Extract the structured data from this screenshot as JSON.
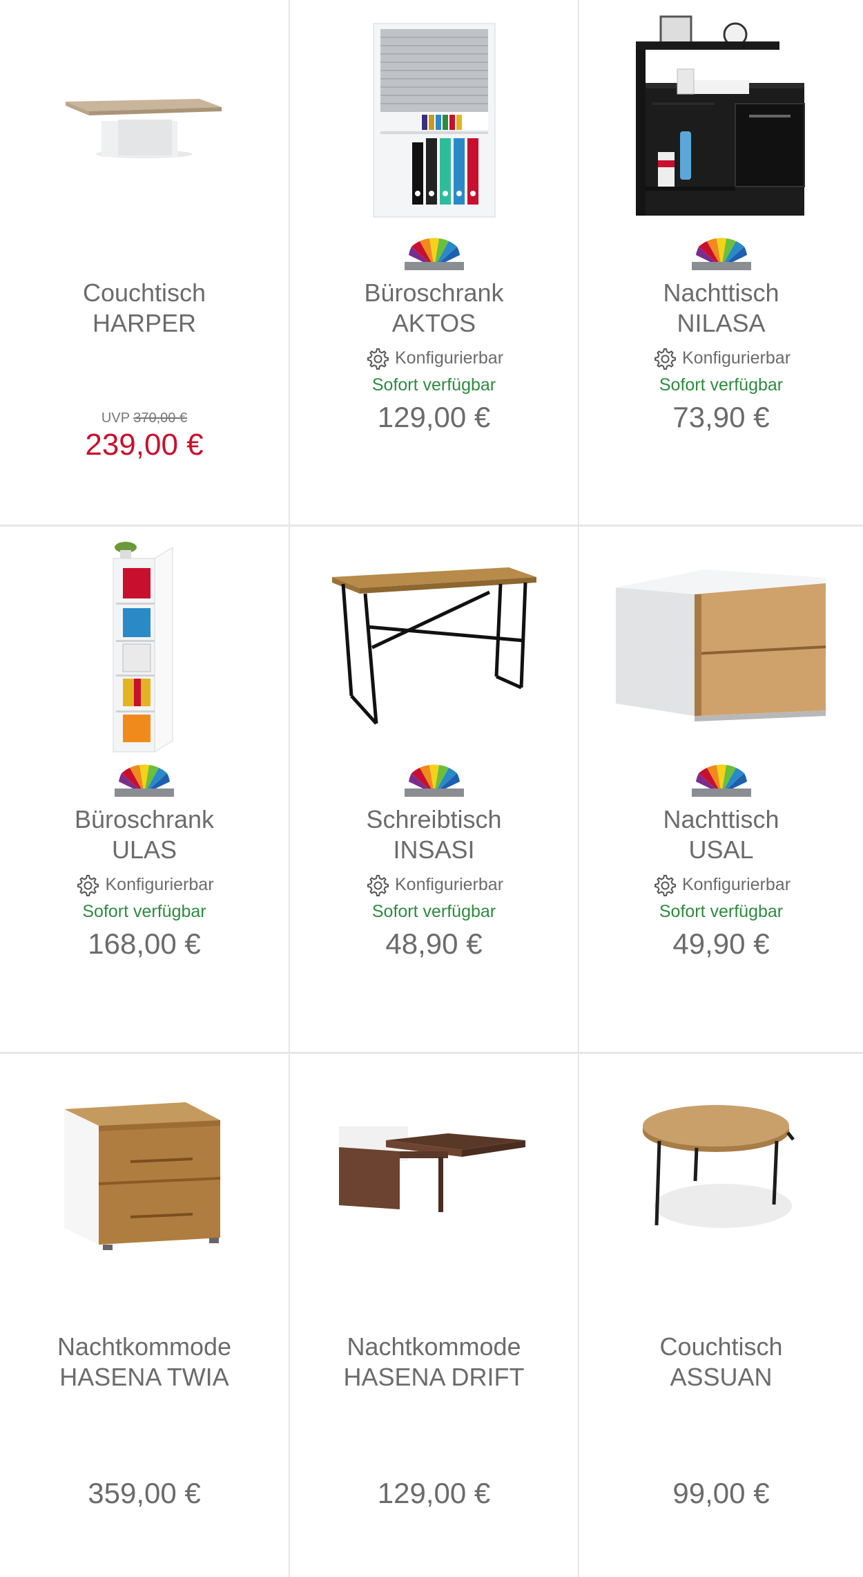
{
  "products": [
    {
      "line1": "Couchtisch",
      "line2": "HARPER",
      "uvp_label": "UVP",
      "uvp_price": "370,00 €",
      "price": "239,00 €"
    },
    {
      "line1": "Büroschrank",
      "line2": "AKTOS",
      "config": "Konfigurierbar",
      "availability": "Sofort verfügbar",
      "price": "129,00 €"
    },
    {
      "line1": "Nachttisch",
      "line2": "NILASA",
      "config": "Konfigurierbar",
      "availability": "Sofort verfügbar",
      "price": "73,90 €"
    },
    {
      "line1": "Büroschrank",
      "line2": "ULAS",
      "config": "Konfigurierbar",
      "availability": "Sofort verfügbar",
      "price": "168,00 €"
    },
    {
      "line1": "Schreibtisch",
      "line2": "INSASI",
      "config": "Konfigurierbar",
      "availability": "Sofort verfügbar",
      "price": "48,90 €"
    },
    {
      "line1": "Nachttisch",
      "line2": "USAL",
      "config": "Konfigurierbar",
      "availability": "Sofort verfügbar",
      "price": "49,90 €"
    },
    {
      "line1": "Nachtkommode",
      "line2": "HASENA TWIA",
      "price": "359,00 €"
    },
    {
      "line1": "Nachtkommode",
      "line2": "HASENA DRIFT",
      "price": "129,00 €"
    },
    {
      "line1": "Couchtisch",
      "line2": "ASSUAN",
      "price": "99,00 €"
    }
  ],
  "colors": {
    "availability": "#2e8b3e",
    "sale_price": "#c8102e",
    "divider": "#e6e6e6"
  }
}
